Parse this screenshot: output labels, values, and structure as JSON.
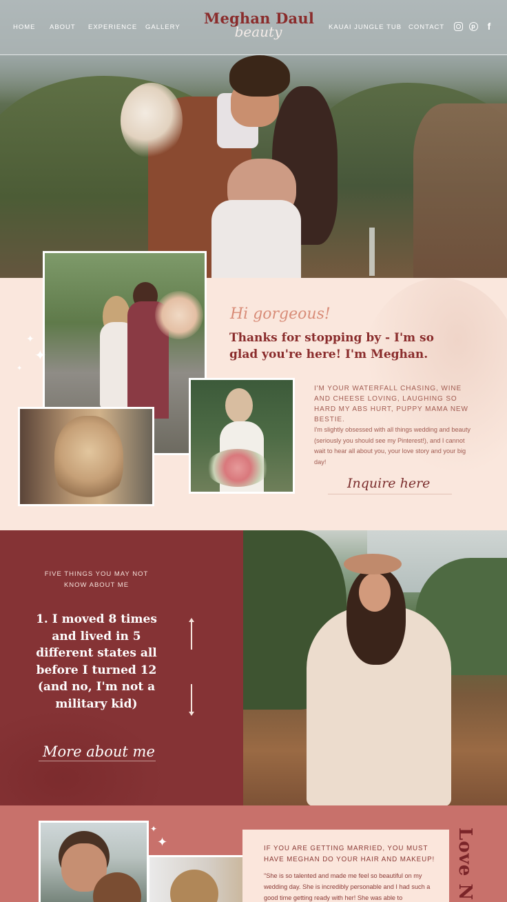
{
  "nav": {
    "left_links": [
      "HOME",
      "ABOUT",
      "EXPERIENCE",
      "GALLERY"
    ],
    "right_links": [
      "KAUAI JUNGLE TUB",
      "CONTACT"
    ],
    "social": [
      "instagram-icon",
      "pinterest-icon",
      "facebook-icon"
    ]
  },
  "logo": {
    "main": "Meghan Daul",
    "script": "beauty"
  },
  "about": {
    "greeting": "Hi gorgeous!",
    "headline": "Thanks for stopping by - I'm so glad you're here! I'm Meghan.",
    "caps_intro": "I'M YOUR WATERFALL CHASING, WINE AND CHEESE LOVING, LAUGHING SO HARD MY ABS HURT, PUPPY MAMA NEW BESTIE.",
    "body": "I'm slightly obsessed with all things wedding and beauty (seriously you should see my Pinterest!), and I cannot wait to hear all about you, your love story and your big day!",
    "cta": "Inquire here"
  },
  "five_things": {
    "label": "FIVE THINGS YOU MAY NOT KNOW ABOUT ME",
    "fact": "1. I moved 8 times and lived in 5 different states all before I turned 12 (and no, I'm not a military kid)",
    "cta": "More about me"
  },
  "testimonial": {
    "caps": "IF YOU ARE GETTING MARRIED, YOU MUST HAVE MEGHAN DO YOUR HAIR AND MAKEUP!",
    "quote": "\"She is so talented and made me feel so beautiful on my wedding day. She is incredibly personable and I had such a good time getting ready with her! She was able to",
    "side_word": "Love N"
  },
  "colors": {
    "brand_red": "#8a2c2c",
    "blush": "#fae7dd",
    "burgundy_panel": "#853335",
    "rose_band": "#c8716b"
  }
}
